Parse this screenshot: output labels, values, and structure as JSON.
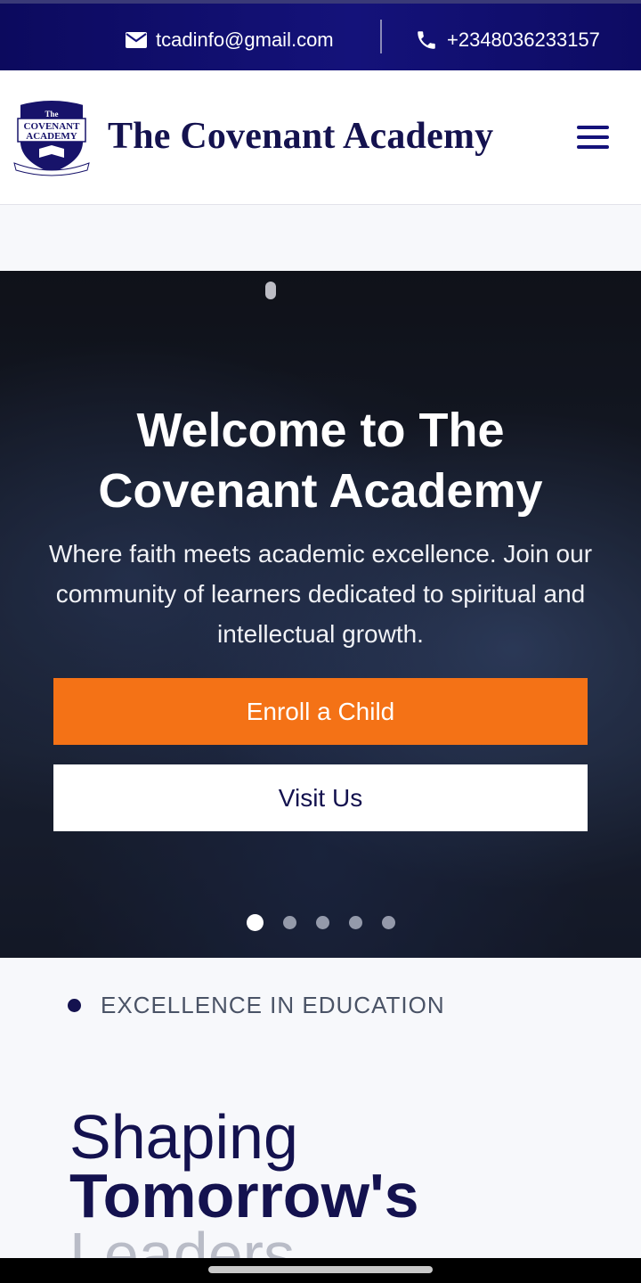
{
  "topbar": {
    "email": "tcadinfo@gmail.com",
    "phone": "+2348036233157"
  },
  "header": {
    "brand": "The Covenant Academy",
    "logo_alt": "The COVENANT ACADEMY Excellence and Virtue"
  },
  "hero": {
    "title": "Welcome to The Covenant Academy",
    "subtitle": "Where faith meets academic excellence. Join our community of learners dedicated to spiritual and intellectual growth.",
    "enroll_label": "Enroll a Child",
    "visit_label": "Visit Us",
    "slides_total": 5,
    "active_slide": 1
  },
  "section": {
    "eyebrow": "EXCELLENCE IN EDUCATION",
    "headline_line1": "Shaping",
    "headline_line2": "Tomorrow's",
    "headline_line3": "Leaders"
  },
  "colors": {
    "brand_navy": "#14124f",
    "topbar_blue": "#14127a",
    "accent_orange": "#f47216"
  },
  "icons": [
    "envelope-icon",
    "phone-icon",
    "hamburger-menu-icon"
  ]
}
